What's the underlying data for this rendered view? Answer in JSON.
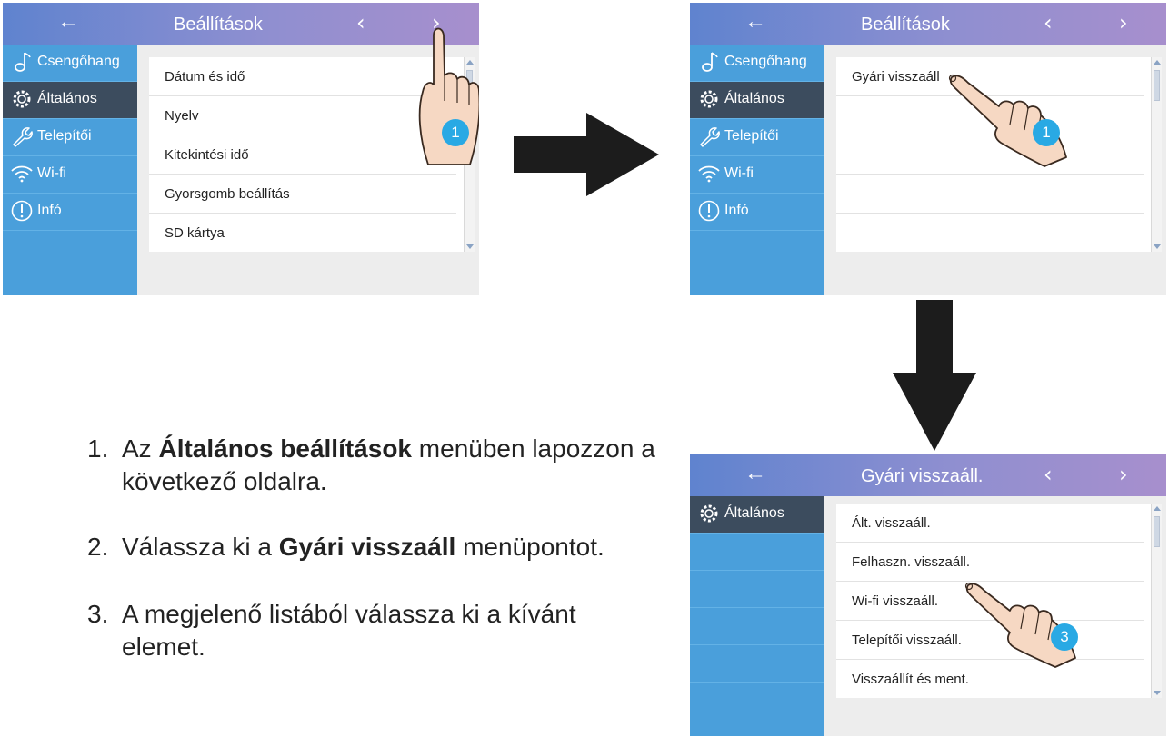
{
  "screens": [
    {
      "header": {
        "back": "←",
        "title": "Beállítások",
        "prev": "‹",
        "next": "›"
      },
      "sidebar": [
        {
          "label": "Csengőhang",
          "icon": "music-note-icon"
        },
        {
          "label": "Általános",
          "icon": "gear-icon",
          "selected": true
        },
        {
          "label": "Telepítői",
          "icon": "wrench-icon"
        },
        {
          "label": "Wi-fi",
          "icon": "wifi-icon"
        },
        {
          "label": "Infó",
          "icon": "info-icon"
        }
      ],
      "items": [
        "Dátum és idő",
        "Nyelv",
        "Kitekintési idő",
        "Gyorsgomb beállítás",
        "SD kártya"
      ],
      "badge": "1"
    },
    {
      "header": {
        "back": "←",
        "title": "Beállítások",
        "prev": "‹",
        "next": "›"
      },
      "sidebar": [
        {
          "label": "Csengőhang",
          "icon": "music-note-icon"
        },
        {
          "label": "Általános",
          "icon": "gear-icon",
          "selected": true
        },
        {
          "label": "Telepítői",
          "icon": "wrench-icon"
        },
        {
          "label": "Wi-fi",
          "icon": "wifi-icon"
        },
        {
          "label": "Infó",
          "icon": "info-icon"
        }
      ],
      "items": [
        "Gyári visszaáll"
      ],
      "badge": "1"
    },
    {
      "header": {
        "back": "←",
        "title": "Gyári visszaáll.",
        "prev": "‹",
        "next": "›"
      },
      "sidebar": [
        {
          "label": "Általános",
          "icon": "gear-icon",
          "selected": true
        }
      ],
      "items": [
        "Ált. visszaáll.",
        "Felhaszn. visszaáll.",
        "Wi-fi visszaáll.",
        "Telepítői visszaáll.",
        "Visszaállít és ment."
      ],
      "badge": "3"
    }
  ],
  "instructions": [
    {
      "num": "1.",
      "before": "Az ",
      "bold": "Általános beállítások",
      "after": " menüben lapozzon a következő oldalra."
    },
    {
      "num": "2.",
      "before": "Válassza ki a ",
      "bold": "Gyári visszaáll",
      "after": " menüpontot."
    },
    {
      "num": "3.",
      "before": "A megjelenő listából válassza ki a kívánt elemet.",
      "bold": "",
      "after": ""
    }
  ],
  "colors": {
    "header_start": "#5f83cf",
    "header_end": "#a78fcd",
    "sidebar": "#4a9fdb",
    "sidebar_selected": "#3c4c5e",
    "badge": "#29a9e4"
  }
}
